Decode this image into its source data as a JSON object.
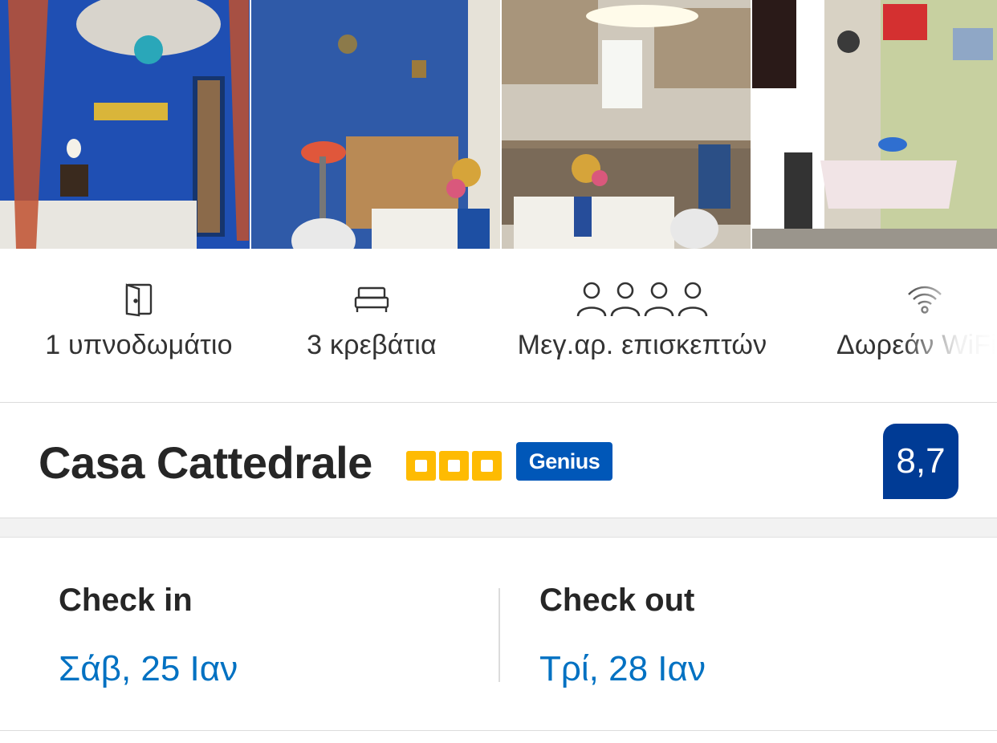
{
  "photos": [
    {
      "name": "bedroom-photo"
    },
    {
      "name": "living-room-photo"
    },
    {
      "name": "kitchen-photo"
    },
    {
      "name": "dining-area-photo"
    }
  ],
  "facilities": [
    {
      "icon": "door-icon",
      "label": "1 υπνοδωμάτιο"
    },
    {
      "icon": "bed-icon",
      "label": "3 κρεβάτια"
    },
    {
      "icon": "guests-icon",
      "label": "Μεγ.αρ. επισκεπτών"
    },
    {
      "icon": "wifi-icon",
      "label": "Δωρεάν WiFi"
    }
  ],
  "property": {
    "name": "Casa Cattedrale",
    "stars": 3,
    "badge": "Genius",
    "score": "8,7"
  },
  "dates": {
    "check_in": {
      "label": "Check in",
      "value": "Σάβ, 25 Ιαν"
    },
    "check_out": {
      "label": "Check out",
      "value": "Τρί, 28 Ιαν"
    }
  },
  "colors": {
    "brand_blue": "#003b95",
    "genius_blue": "#0057b8",
    "link_blue": "#0071c2",
    "star_yellow": "#febb02"
  }
}
